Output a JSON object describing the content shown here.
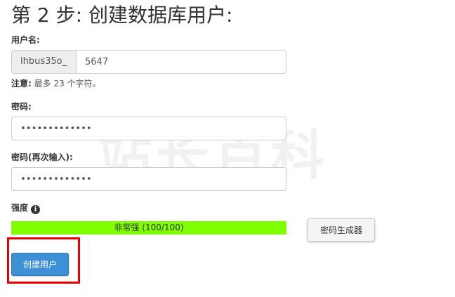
{
  "page": {
    "title": "第 2 步: 创建数据库用户:",
    "watermark": "站长百科"
  },
  "username": {
    "label": "用户名:",
    "prefix": "lhbus35o_",
    "value": "5647",
    "note_prefix": "注意:",
    "note_text": " 最多 23 个字符。"
  },
  "password": {
    "label": "密码:",
    "value": "•••••••••••••"
  },
  "password_confirm": {
    "label": "密码(再次输入):",
    "value": "•••••••••••••"
  },
  "strength": {
    "label": "强度",
    "info_icon": "i",
    "bar_text": "非常强 (100/100)",
    "score": 100,
    "max": 100,
    "color": "#7fff00"
  },
  "buttons": {
    "generate": "密码生成器",
    "create": "创建用户"
  },
  "colors": {
    "primary": "#3d8fd6",
    "highlight": "#e60000"
  }
}
